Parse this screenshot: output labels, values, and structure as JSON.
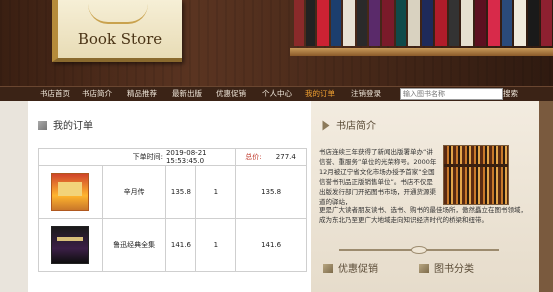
{
  "header": {
    "logo_text": "Book Store"
  },
  "nav": {
    "items": [
      "书店首页",
      "书店简介",
      "精品推荐",
      "最新出版",
      "优惠促销",
      "个人中心",
      "我的订单",
      "注销登录"
    ],
    "active_index": 6,
    "search_placeholder": "输入图书名称",
    "search_button": "搜索"
  },
  "orders": {
    "title": "我的订单",
    "time_label": "下单时间:",
    "time_value": "2019-08-21 15:53:45.0",
    "total_label": "总价:",
    "total_value": "277.4",
    "items": [
      {
        "name": "辛月传",
        "price": "135.8",
        "qty": "1",
        "subtotal": "135.8"
      },
      {
        "name": "鲁迅经典全集",
        "price": "141.6",
        "qty": "1",
        "subtotal": "141.6"
      }
    ]
  },
  "sidebar": {
    "title": "书店简介",
    "intro_top": "书店连续三年获得了新闻出版署单办“讲信誉、重服务”单位的光荣称号。2000年12月被辽宁省文化市场办授予首家“全国信誉书刊品正版销售单位”。书店不仅是出版发行部门开拓图书市场，开通货源渠道的驿站，",
    "intro_bottom": "更是广大读者朋友读书、选书、购书的最佳场所，傲然矗立在图书领域，成为东北乃至更广大地域走向知识经济时代的桥梁和纽带。",
    "promo_label": "优惠促销",
    "category_label": "图书分类"
  }
}
